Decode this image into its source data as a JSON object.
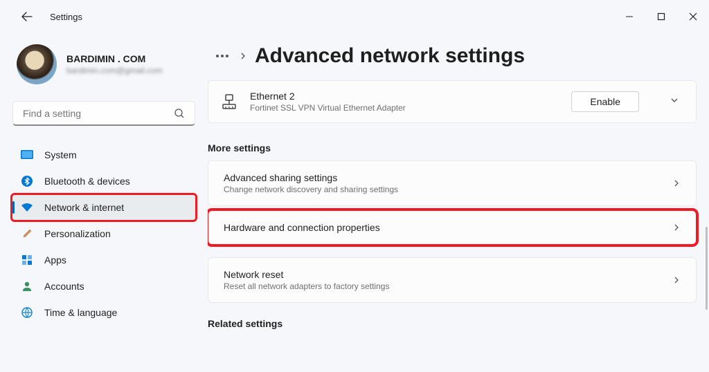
{
  "window": {
    "title": "Settings"
  },
  "profile": {
    "name": "BARDIMIN . COM",
    "email": "bardimin.com@gmail.com"
  },
  "search": {
    "placeholder": "Find a setting"
  },
  "sidebar": {
    "items": [
      {
        "label": "System",
        "icon": "system"
      },
      {
        "label": "Bluetooth & devices",
        "icon": "bluetooth"
      },
      {
        "label": "Network & internet",
        "icon": "wifi",
        "selected": true,
        "highlighted": true
      },
      {
        "label": "Personalization",
        "icon": "brush"
      },
      {
        "label": "Apps",
        "icon": "apps"
      },
      {
        "label": "Accounts",
        "icon": "person"
      },
      {
        "label": "Time & language",
        "icon": "globe"
      }
    ]
  },
  "page": {
    "title": "Advanced network settings"
  },
  "adapter": {
    "name": "Ethernet 2",
    "desc": "Fortinet SSL VPN Virtual Ethernet Adapter",
    "button": "Enable"
  },
  "more_settings": {
    "heading": "More settings",
    "items": [
      {
        "title": "Advanced sharing settings",
        "sub": "Change network discovery and sharing settings"
      },
      {
        "title": "Hardware and connection properties",
        "sub": "",
        "highlighted": true
      },
      {
        "title": "Network reset",
        "sub": "Reset all network adapters to factory settings"
      }
    ]
  },
  "related": {
    "heading": "Related settings"
  }
}
